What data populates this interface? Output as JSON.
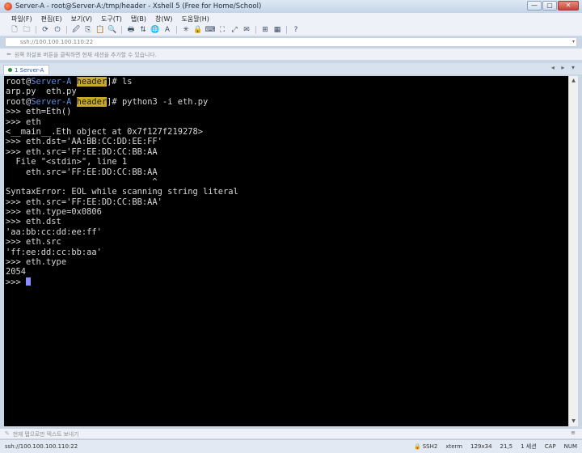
{
  "window": {
    "title": "Server-A - root@Server-A:/tmp/header - Xshell 5 (Free for Home/School)",
    "controls": {
      "minimize": "—",
      "maximize": "▢",
      "close": "✕"
    }
  },
  "menu": [
    {
      "label": "파일(F)"
    },
    {
      "label": "편집(E)"
    },
    {
      "label": "보기(V)"
    },
    {
      "label": "도구(T)"
    },
    {
      "label": "탭(B)"
    },
    {
      "label": "창(W)"
    },
    {
      "label": "도움말(H)"
    }
  ],
  "toolbar": {
    "icons": [
      "new-session-icon",
      "open-folder-icon",
      "reconnect-icon",
      "disconnect-icon",
      "properties-icon",
      "copy-icon",
      "paste-icon",
      "find-icon",
      "print-icon",
      "transfer-icon",
      "globe-icon",
      "font-icon",
      "color-icon",
      "lock-icon",
      "keyboard-icon",
      "fullscreen-icon",
      "zoom-icon",
      "compose-icon",
      "new-tab-icon",
      "tile-icon",
      "help-icon"
    ],
    "glyphs": [
      "🗋",
      "🗀",
      "⟳",
      "⏻",
      "🖉",
      "⎘",
      "📋",
      "🔍",
      "🖶",
      "⇅",
      "🌐",
      "A",
      "✳",
      "🔒",
      "⌨",
      "⛶",
      "⤢",
      "✉",
      "⊞",
      "▦",
      "?"
    ]
  },
  "address": {
    "value": "ssh://100.100.100.110:22",
    "dropdown": "▾"
  },
  "quickbar": {
    "text": "원쪽 화살표 버튼을 클릭하면 현재 세션을 추가할 수 있습니다."
  },
  "tabs": [
    {
      "label": "1 Server-A"
    }
  ],
  "tab_nav": "◂ ▸ ▾",
  "terminal": {
    "prompt": {
      "user": "root",
      "at": "@",
      "host": "Server-A",
      "dir": "header",
      "suffix": "]# "
    },
    "cmd1": "ls",
    "out1": "arp.py  eth.py",
    "cmd2": "python3 -i eth.py",
    "lines": [
      ">>> eth=Eth()",
      ">>> eth",
      "<__main__.Eth object at 0x7f127f219278>",
      ">>> eth.dst='AA:BB:CC:DD:EE:FF'",
      ">>> eth.src='FF:EE:DD:CC:BB:AA",
      "  File \"<stdin>\", line 1",
      "    eth.src='FF:EE:DD:CC:BB:AA",
      "                             ^",
      "SyntaxError: EOL while scanning string literal",
      ">>> eth.src='FF:EE:DD:CC:BB:AA'",
      ">>> eth.type=0x0806",
      ">>> eth.dst",
      "'aa:bb:cc:dd:ee:ff'",
      ">>> eth.src",
      "'ff:ee:dd:cc:bb:aa'",
      ">>> eth.type",
      "2054"
    ],
    "last_prompt": ">>> "
  },
  "compose": {
    "text": "현재 탭으로만 텍스트 보내기",
    "menu": "≡"
  },
  "status": {
    "address": "ssh://100.100.100.110:22",
    "protocol": "SSH2",
    "term": "xterm",
    "size": "129x34",
    "position": "21,5",
    "sessions": "1 세션",
    "caps": "CAP",
    "num": "NUM"
  }
}
